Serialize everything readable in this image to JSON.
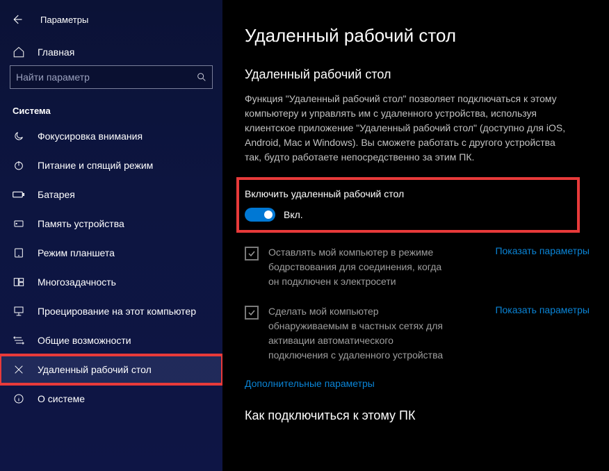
{
  "window": {
    "title": "Параметры"
  },
  "sidebar": {
    "home_label": "Главная",
    "search_placeholder": "Найти параметр",
    "section_label": "Система",
    "items": [
      {
        "label": "Фокусировка внимания",
        "icon": "moon"
      },
      {
        "label": "Питание и спящий режим",
        "icon": "power"
      },
      {
        "label": "Батарея",
        "icon": "battery"
      },
      {
        "label": "Память устройства",
        "icon": "storage"
      },
      {
        "label": "Режим планшета",
        "icon": "tablet"
      },
      {
        "label": "Многозадачность",
        "icon": "multitask"
      },
      {
        "label": "Проецирование на этот компьютер",
        "icon": "project"
      },
      {
        "label": "Общие возможности",
        "icon": "shared"
      },
      {
        "label": "Удаленный рабочий стол",
        "icon": "remote",
        "selected": true
      },
      {
        "label": "О системе",
        "icon": "about"
      }
    ]
  },
  "main": {
    "heading": "Удаленный рабочий стол",
    "subheading": "Удаленный рабочий стол",
    "description": "Функция \"Удаленный рабочий стол\" позволяет подключаться к этому компьютеру и управлять им с удаленного устройства, используя клиентское приложение \"Удаленный рабочий стол\" (доступно для iOS, Android, Mac и Windows). Вы сможете работать с другого устройства так, будто работаете непосредственно за этим ПК.",
    "toggle": {
      "label": "Включить удаленный рабочий стол",
      "state": "Вкл.",
      "on": true
    },
    "options": [
      {
        "text": "Оставлять мой компьютер в режиме бодрствования для соединения, когда он подключен к электросети",
        "link": "Показать параметры",
        "checked": true
      },
      {
        "text": "Сделать мой компьютер обнаруживаемым в частных сетях для активации автоматического подключения с удаленного устройства",
        "link": "Показать параметры",
        "checked": true
      }
    ],
    "advanced_link": "Дополнительные параметры",
    "connect_heading": "Как подключиться к этому ПК"
  }
}
